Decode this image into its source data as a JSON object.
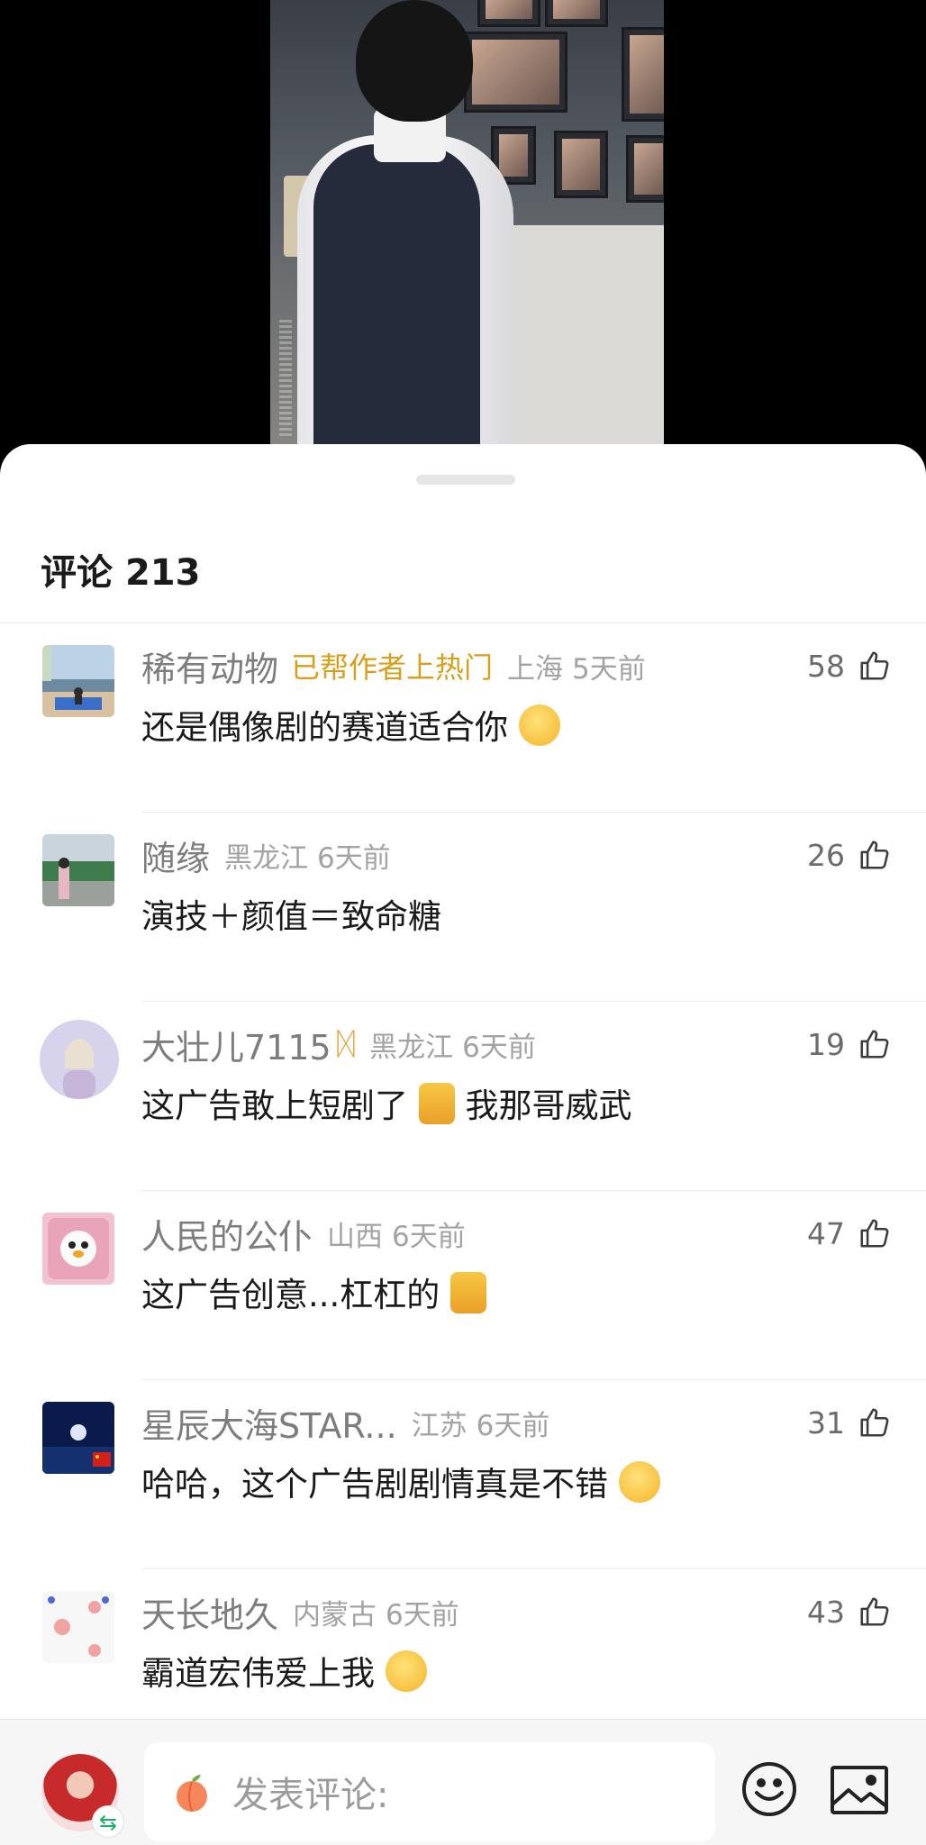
{
  "sheet": {
    "title": "评论",
    "count": "213"
  },
  "comments": [
    {
      "user": "稀有动物",
      "tag": "已帮作者上热门",
      "location": "上海",
      "time": "5天前",
      "likes": "58",
      "text": "还是偶像剧的赛道适合你",
      "emoji": "666-face-emoji"
    },
    {
      "user": "随缘",
      "location": "黑龙江",
      "time": "6天前",
      "likes": "26",
      "text": "演技＋颜值＝致命糖"
    },
    {
      "user": "大壮儿7115",
      "badge": "ᛞ",
      "location": "黑龙江",
      "time": "6天前",
      "likes": "19",
      "text": "这广告敢上短剧了",
      "text2": "我那哥威武"
    },
    {
      "user": "人民的公仆",
      "location": "山西",
      "time": "6天前",
      "likes": "47",
      "text": "这广告创意...杠杠的"
    },
    {
      "user": "星辰大海STAR...",
      "location": "江苏",
      "time": "6天前",
      "likes": "31",
      "text": "哈哈，这个广告剧剧情真是不错"
    },
    {
      "user": "天长地久",
      "location": "内蒙古",
      "time": "6天前",
      "likes": "43",
      "text": "霸道宏伟爱上我"
    }
  ],
  "input": {
    "placeholder": "发表评论:",
    "switch_glyph": "⇆"
  },
  "colors": {
    "tag": "#d8a01a",
    "accent": "#18b266"
  }
}
